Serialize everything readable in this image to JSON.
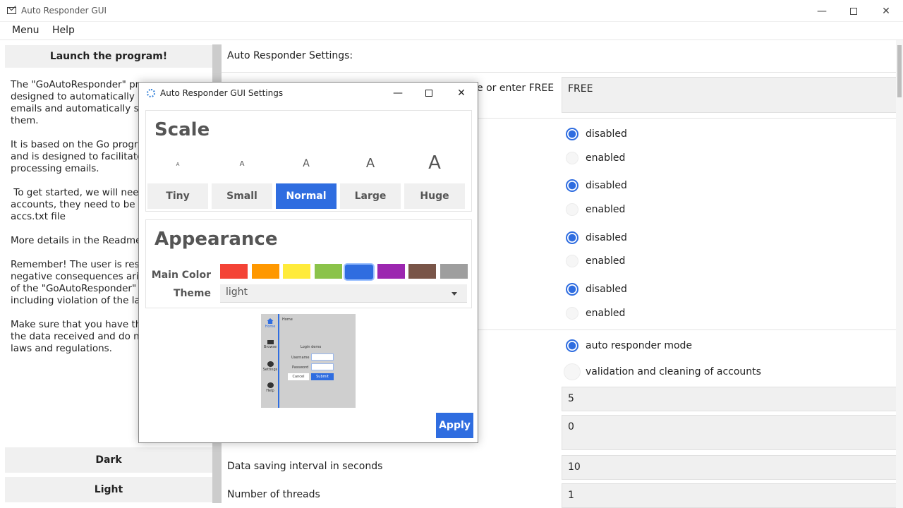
{
  "window": {
    "title": "Auto Responder GUI"
  },
  "menu": [
    "Menu",
    "Help"
  ],
  "left": {
    "launch_label": "Launch the program!",
    "paragraphs": [
      "The \"GoAutoResponder\" prog\ndesigned to automatically mo\nemails and automatically send\nthem.",
      "It is based on the Go program\nand is designed to facilitate th\nprocessing emails.",
      " To get started, we will need IM\naccounts, they need to be sav\naccs.txt file",
      "More details in the Readme",
      "Remember! The user is respon\nnegative consequences arisin\nof the \"GoAutoResponder\" pro\nincluding violation of the law.",
      "Make sure that you have the r\nthe data received and do not v\nlaws and regulations."
    ],
    "dark_label": "Dark",
    "light_label": "Light"
  },
  "right": {
    "header": "Auto Responder Settings:",
    "license_label": "e or enter FREE",
    "license_value": "FREE",
    "radio_groups": [
      {
        "options": [
          "disabled",
          "enabled"
        ],
        "selected": 0
      },
      {
        "options": [
          "disabled",
          "enabled"
        ],
        "selected": 0
      },
      {
        "options": [
          "disabled",
          "enabled"
        ],
        "selected": 0
      },
      {
        "options": [
          "disabled",
          "enabled"
        ],
        "selected": 0
      }
    ],
    "mode_options": [
      "auto responder mode",
      "validation and cleaning of accounts"
    ],
    "mode_selected": 0,
    "field_a": "5",
    "field_b": "0",
    "saving_label": "Data saving interval in seconds",
    "saving_value": "10",
    "threads_label": "Number of threads",
    "threads_value": "1"
  },
  "dialog": {
    "title": "Auto Responder GUI Settings",
    "scale": {
      "title": "Scale",
      "glyph": "A",
      "options": [
        "Tiny",
        "Small",
        "Normal",
        "Large",
        "Huge"
      ],
      "selected": "Normal"
    },
    "appearance": {
      "title": "Appearance",
      "main_color_label": "Main Color",
      "theme_label": "Theme",
      "theme_value": "light",
      "colors": [
        "#f44336",
        "#ff9800",
        "#ffeb3b",
        "#8bc34a",
        "#2f6de0",
        "#9c27b0",
        "#795548",
        "#9e9e9e"
      ],
      "selected_color": "#2f6de0"
    },
    "preview": {
      "header": "Home",
      "nav": [
        "Home",
        "Browse",
        "Settings",
        "Help"
      ],
      "form_title": "Login demo",
      "username_label": "Username",
      "password_label": "Password",
      "cancel_label": "Cancel",
      "submit_label": "Submit"
    },
    "apply_label": "Apply"
  }
}
